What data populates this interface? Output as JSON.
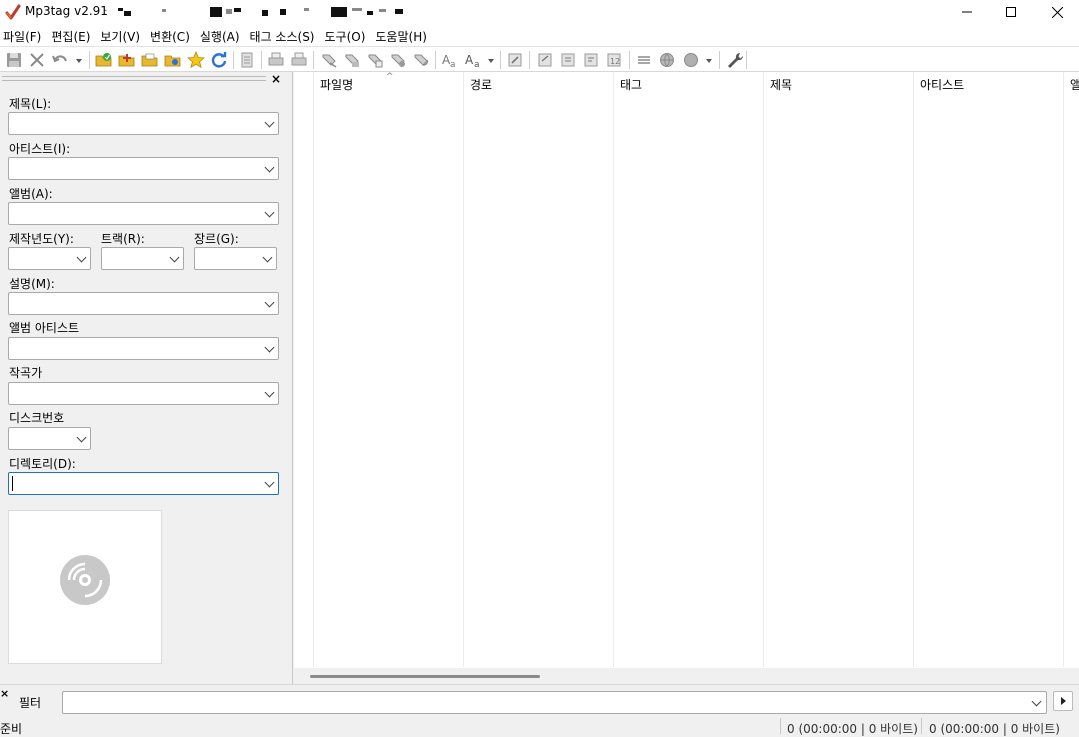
{
  "window": {
    "title": "Mp3tag v2.91",
    "path_prefix": "·"
  },
  "menu": [
    "파일(F)",
    "편집(E)",
    "보기(V)",
    "변환(C)",
    "실행(A)",
    "태그 소스(S)",
    "도구(O)",
    "도움말(H)"
  ],
  "panel": {
    "title_label": "제목(L):",
    "artist_label": "아티스트(I):",
    "album_label": "앨범(A):",
    "year_label": "제작년도(Y):",
    "track_label": "트랙(R):",
    "genre_label": "장르(G):",
    "comment_label": "설명(M):",
    "album_artist_label": "앨범 아티스트",
    "composer_label": "작곡가",
    "disc_label": "디스크번호",
    "directory_label": "디렉토리(D):",
    "values": {
      "title": "",
      "artist": "",
      "album": "",
      "year": "",
      "track": "",
      "genre": "",
      "comment": "",
      "album_artist": "",
      "composer": "",
      "disc": "",
      "directory": ""
    }
  },
  "columns": [
    "파일명",
    "경로",
    "태그",
    "제목",
    "아티스트",
    "앨"
  ],
  "filter": {
    "label": "필터",
    "value": ""
  },
  "status": {
    "text": "준비",
    "selected": "0 (00:00:00 | 0 바이트)",
    "total": "0 (00:00:00 | 0 바이트)"
  },
  "colors": {
    "accent": "#1e6fcf",
    "folder": "#e8b830",
    "refresh": "#2a72d6"
  }
}
